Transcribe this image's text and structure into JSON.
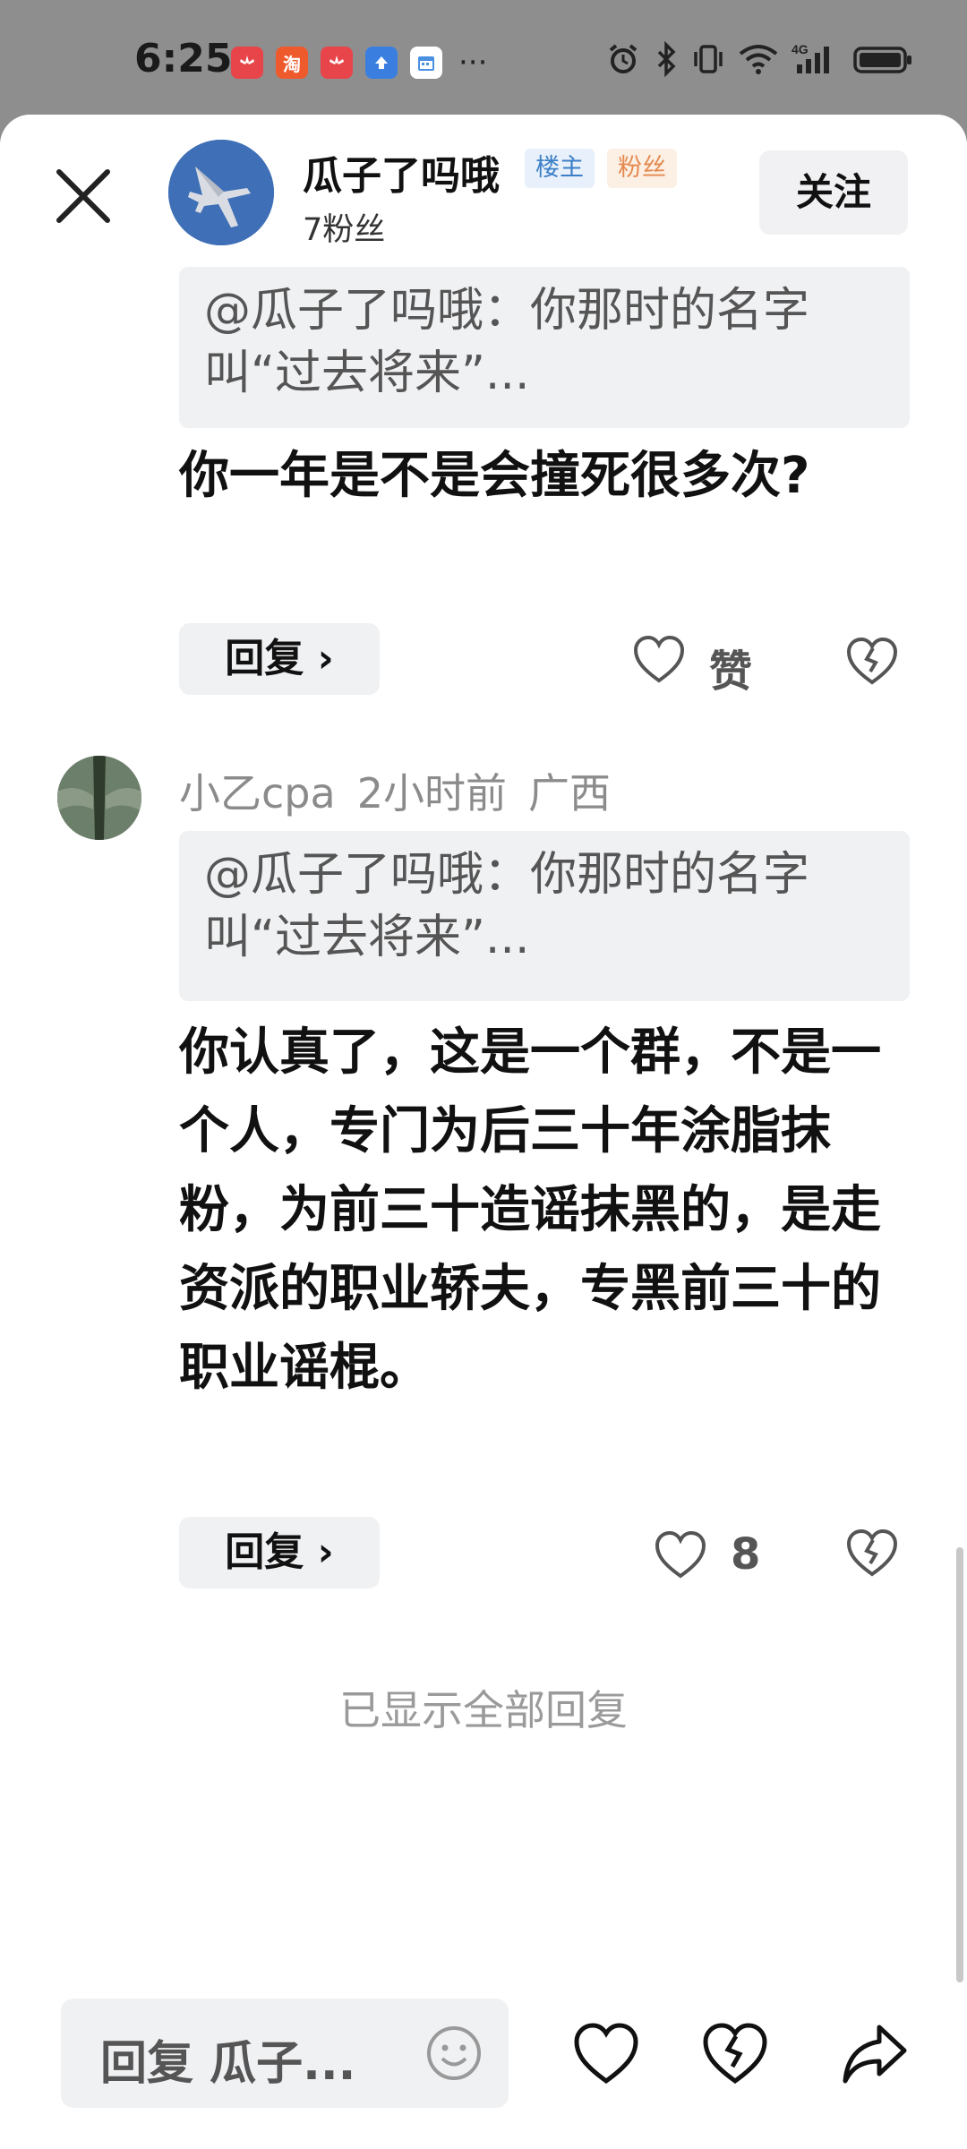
{
  "status_bar": {
    "time": "6:25",
    "apps": [
      {
        "name": "huawei-app-icon",
        "label": "HUAWEI",
        "color": "#e8454b"
      },
      {
        "name": "taobao-app-icon",
        "label": "淘",
        "color": "#ef5a2c"
      },
      {
        "name": "huawei-app-icon",
        "label": "HUAWEI",
        "color": "#e8454b"
      },
      {
        "name": "upload-app-icon",
        "label": "",
        "color": "#3a7fe0"
      },
      {
        "name": "calendar-app-icon",
        "label": "",
        "color": "#ffffff"
      }
    ],
    "more": "···",
    "network": "4G"
  },
  "header": {
    "username": "瓜子了吗哦",
    "badge_host": "楼主",
    "badge_fan": "粉丝",
    "fans": "7粉丝",
    "follow": "关注"
  },
  "replies": [
    {
      "quote": "@瓜子了吗哦：你那时的名字叫“过去将来”...",
      "content": "你一年是不是会撞死很多次?",
      "reply_label": "回复 ›",
      "like_label": "赞"
    },
    {
      "user": "小乙cpa",
      "time": "2小时前",
      "location": "广西",
      "quote": "@瓜子了吗哦：你那时的名字叫“过去将来”...",
      "content": "你认真了，这是一个群，不是一个人，专门为后三十年涂脂抹粉，为前三十造谣抹黑的，是走资派的职业轿夫，专黑前三十的职业谣棍。",
      "reply_label": "回复 ›",
      "like_label": "8"
    }
  ],
  "all_shown": "已显示全部回复",
  "bottom_bar": {
    "input_placeholder": "回复 瓜子..."
  },
  "colors": {
    "accent_blue": "#3d7fc6",
    "accent_orange": "#e4894e",
    "grey_bg": "#f0f1f3"
  }
}
